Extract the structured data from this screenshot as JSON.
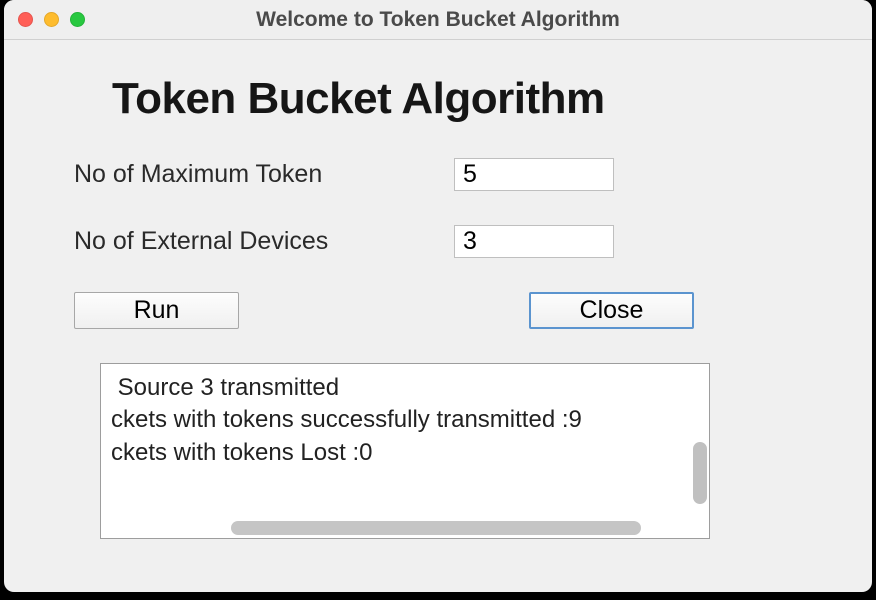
{
  "window": {
    "title": "Welcome to Token Bucket Algorithm"
  },
  "heading": "Token Bucket Algorithm",
  "fields": {
    "maxToken": {
      "label": "No of Maximum Token",
      "value": "5"
    },
    "externalDevices": {
      "label": "No of External Devices",
      "value": "3"
    }
  },
  "buttons": {
    "run": "Run",
    "close": "Close"
  },
  "output": " Source 3 transmitted\nckets with tokens successfully transmitted :9\nckets with tokens Lost :0"
}
